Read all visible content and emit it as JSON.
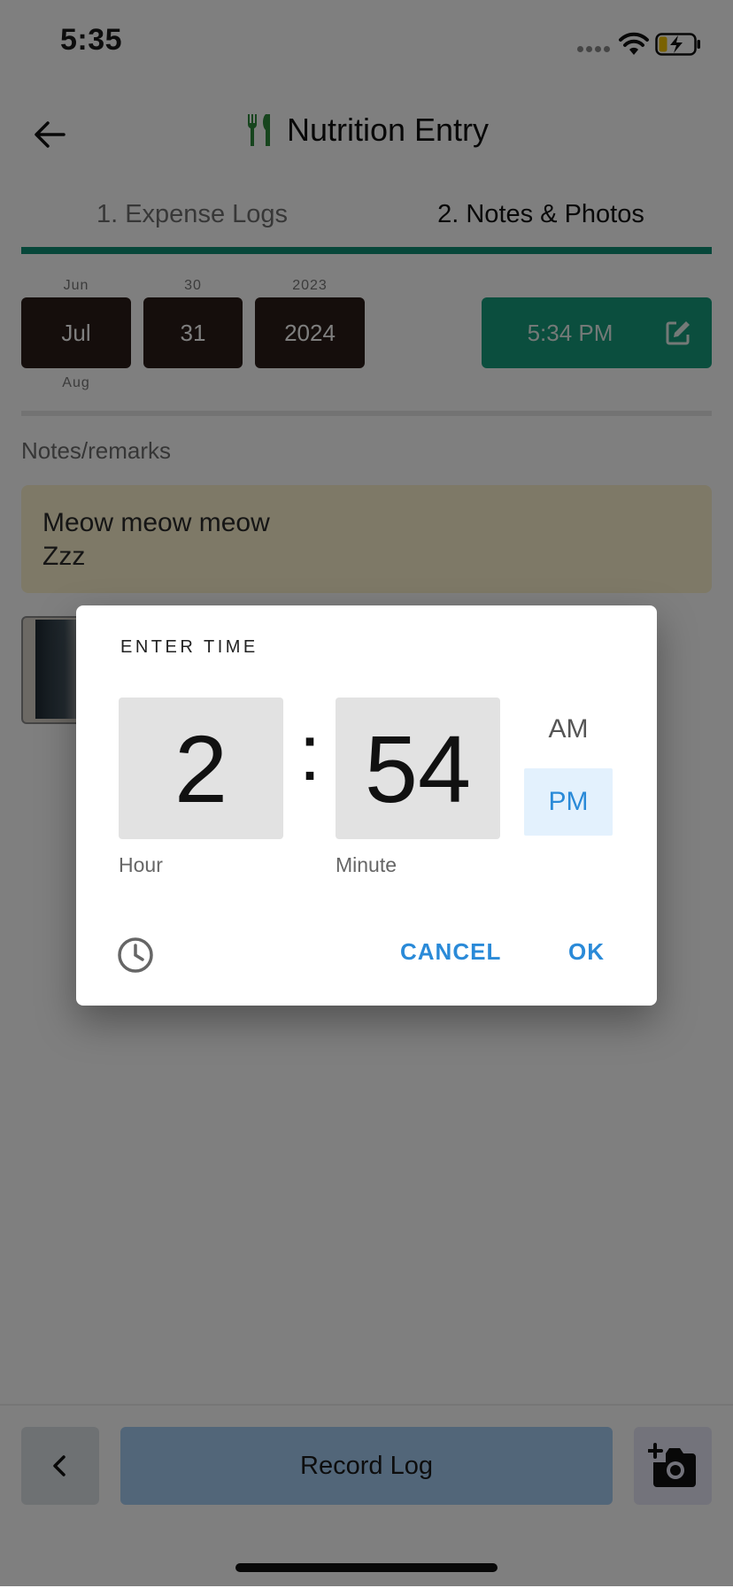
{
  "status_bar": {
    "time": "5:35"
  },
  "header": {
    "title": "Nutrition Entry"
  },
  "tabs": [
    {
      "label": "1. Expense Logs"
    },
    {
      "label": "2. Notes & Photos"
    }
  ],
  "date_picker": {
    "month": {
      "prev": "Jun",
      "selected": "Jul",
      "next": "Aug"
    },
    "day": {
      "prev": "30",
      "selected": "31"
    },
    "year": {
      "prev": "2023",
      "selected": "2024"
    }
  },
  "time_button": {
    "label": "5:34 PM"
  },
  "notes": {
    "label": "Notes/remarks",
    "text": "Meow meow meow\nZzz"
  },
  "bottom_bar": {
    "record_label": "Record Log"
  },
  "time_dialog": {
    "title": "ENTER TIME",
    "hour": "2",
    "separator": ":",
    "minute": "54",
    "am_label": "AM",
    "pm_label": "PM",
    "selected_period": "PM",
    "hour_label": "Hour",
    "minute_label": "Minute",
    "cancel_label": "CANCEL",
    "ok_label": "OK"
  },
  "colors": {
    "accent_green": "#169c7c",
    "dialog_blue": "#2a8ad8",
    "wheel_bg": "#2b1d18",
    "notes_bg": "#fdf2cf"
  }
}
